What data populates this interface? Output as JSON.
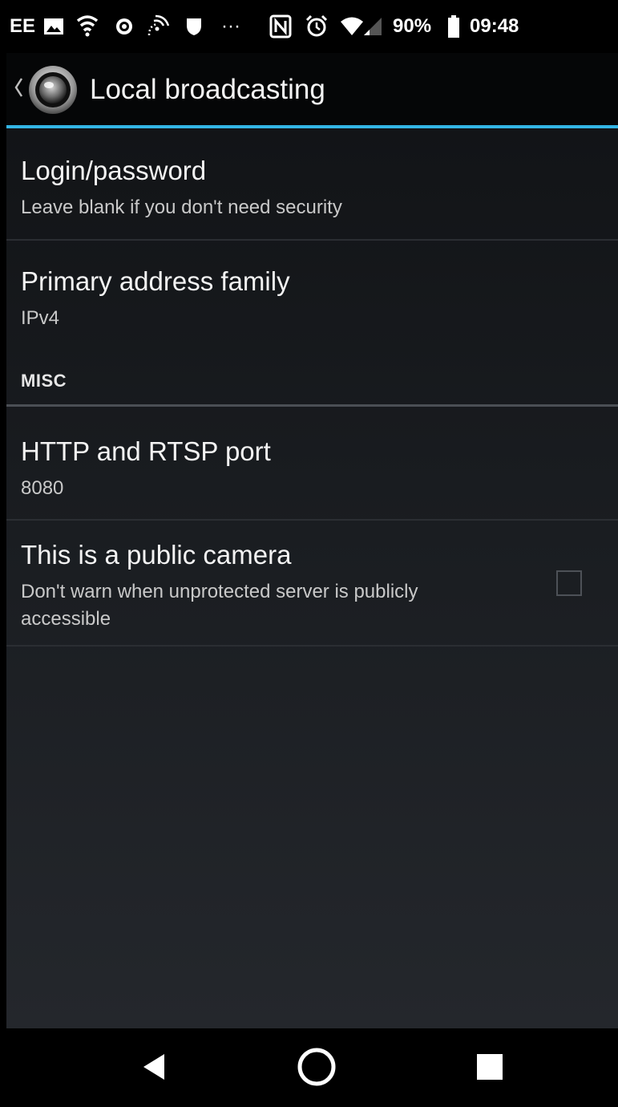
{
  "status_bar": {
    "carrier": "EE",
    "battery_percent": "90%",
    "battery_level": 0.9,
    "time": "09:48",
    "icons": [
      "image-icon",
      "wifi-hotspot-icon",
      "vpn-icon",
      "cast-icon",
      "shield-icon",
      "more-icon",
      "nfc-icon",
      "alarm-icon",
      "wifi-icon",
      "signal-icon",
      "battery-icon"
    ],
    "more_dots": "···"
  },
  "action_bar": {
    "title": "Local broadcasting",
    "accent_color": "#33b5e5"
  },
  "preferences": [
    {
      "title": "Login/password",
      "summary": "Leave blank if you don't need security"
    },
    {
      "title": "Primary address family",
      "summary": "IPv4"
    }
  ],
  "misc_category": {
    "label": "MISC"
  },
  "misc_preferences": [
    {
      "title": "HTTP and RTSP port",
      "summary": "8080"
    },
    {
      "title": "This is a public camera",
      "summary": "Don't warn when unprotected server is publicly accessible",
      "checked": false
    }
  ],
  "nav_bar": {
    "buttons": [
      "back-icon",
      "home-icon",
      "recents-icon"
    ]
  }
}
